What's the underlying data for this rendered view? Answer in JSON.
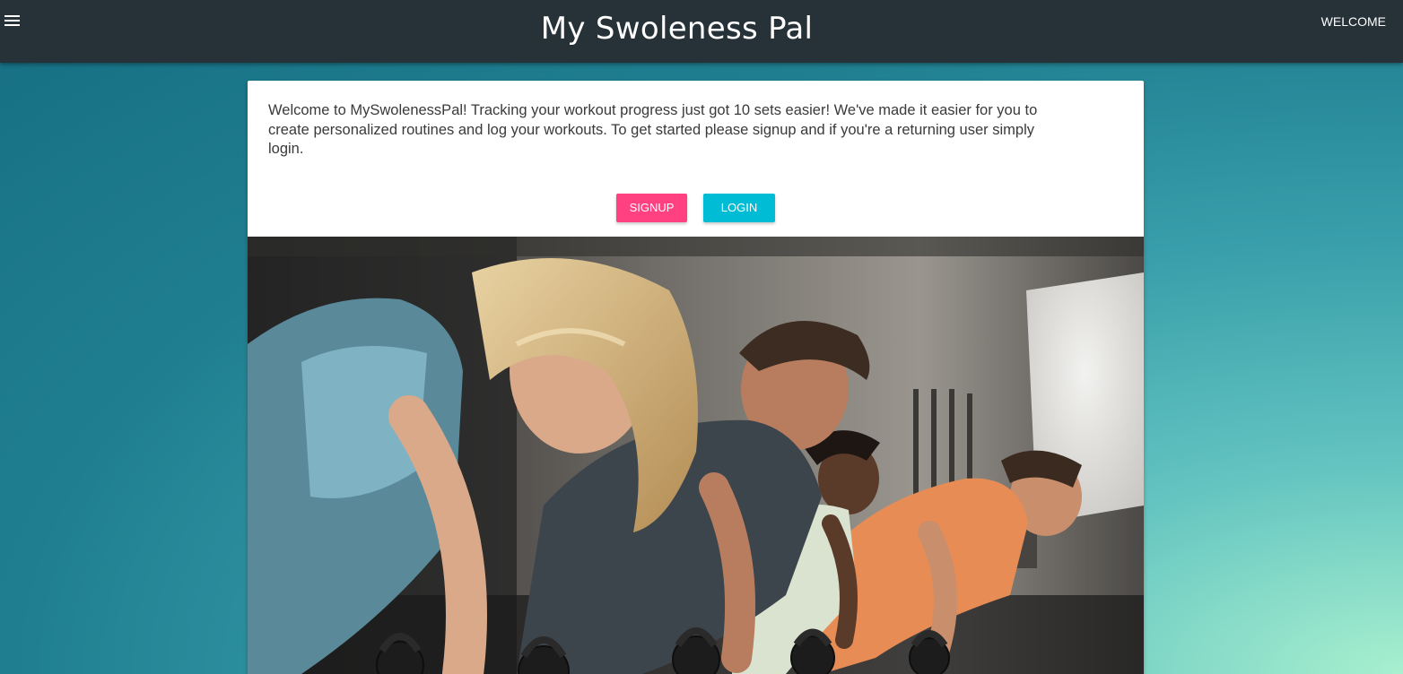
{
  "navbar": {
    "menu_icon": "hamburger-menu-icon",
    "title": "My Swoleness Pal",
    "welcome_link": "WELCOME"
  },
  "main": {
    "intro_text": "Welcome to MySwolenessPal! Tracking your workout progress just got 10 sets easier! We've made it easier for you to create personalized routines and log your workouts. To get started please signup and if you're a returning user simply login.",
    "buttons": {
      "signup_label": "SIGNUP",
      "login_label": "LOGIN"
    }
  },
  "colors": {
    "navbar_bg": "#263238",
    "signup_button": "#ff4081",
    "login_button": "#00bcd4",
    "background_gradient": [
      "#166e82",
      "#3a9fab",
      "#a8f0cf"
    ]
  }
}
